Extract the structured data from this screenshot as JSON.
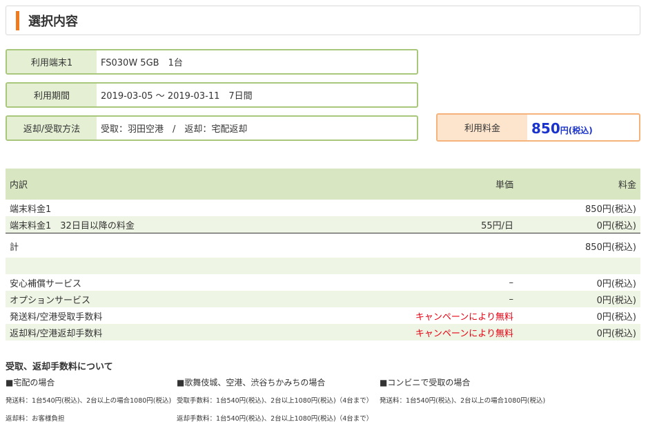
{
  "header": {
    "title": "選択内容"
  },
  "info": [
    {
      "label": "利用端末1",
      "value": "FS030W 5GB　1台"
    },
    {
      "label": "利用期間",
      "value": "2019-03-05 ～ 2019-03-11　7日間"
    },
    {
      "label": "返却/受取方法",
      "value": "受取：羽田空港　/　返却：宅配返却"
    }
  ],
  "price": {
    "label": "利用料金",
    "amount": "850",
    "unit": "円(税込)"
  },
  "table": {
    "headers": {
      "item": "内訳",
      "unit_price": "単価",
      "fee": "料金"
    },
    "rows": [
      {
        "item": "端末料金1",
        "unit_price": "",
        "fee": "850円(税込)"
      },
      {
        "item": "端末料金1　32日目以降の料金",
        "unit_price": "55円/日",
        "fee": "0円(税込)"
      }
    ],
    "total": {
      "item": "計",
      "fee": "850円(税込)"
    },
    "services": [
      {
        "item": "安心補償サービス",
        "unit_price": "–",
        "fee": "0円(税込)"
      },
      {
        "item": "オプションサービス",
        "unit_price": "–",
        "fee": "0円(税込)"
      },
      {
        "item": "発送料/空港受取手数料",
        "unit_price": "キャンペーンにより無料",
        "fee": "0円(税込)"
      },
      {
        "item": "返却料/空港返却手数料",
        "unit_price": "キャンペーンにより無料",
        "fee": "0円(税込)"
      }
    ]
  },
  "fees": {
    "title": "受取、返却手数料について",
    "columns": [
      {
        "heading": "■宅配の場合",
        "lines": [
          "発送料：1台540円(税込)、2台以上の場合1080円(税込)",
          "返却料：お客様負担"
        ]
      },
      {
        "heading": "■歌舞伎城、空港、渋谷ちかみちの場合",
        "lines": [
          "受取手数料：1台540円(税込)、2台以上1080円(税込)（4台まで）",
          "返却手数料：1台540円(税込)、2台以上1080円(税込)（4台まで）"
        ]
      },
      {
        "heading": "■コンビニで受取の場合",
        "lines": [
          "発送料：1台540円(税込)、2台以上の場合1080円(税込)"
        ]
      }
    ]
  }
}
